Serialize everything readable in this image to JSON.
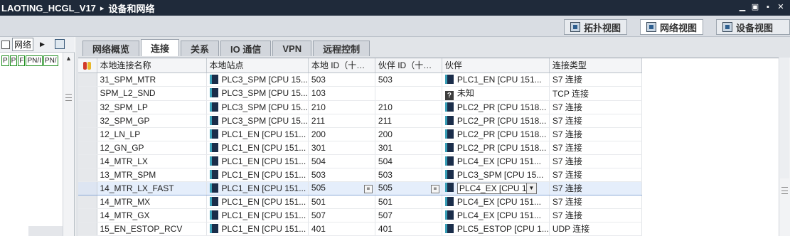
{
  "title": {
    "project": "LAOTING_HCGL_V17",
    "separator": "▸",
    "section": "设备和网络",
    "controls": [
      "▁",
      "▣",
      "▪",
      "✕"
    ]
  },
  "views": [
    {
      "label": "拓扑视图",
      "icon": "topology-view-icon"
    },
    {
      "label": "网络视图",
      "icon": "network-view-icon",
      "active": true
    },
    {
      "label": "设备视图",
      "icon": "device-view-icon"
    }
  ],
  "leftpane": {
    "network_label": "网络",
    "ports": [
      "P",
      "P",
      "F",
      "PN/I",
      "PN/"
    ]
  },
  "tabs": [
    {
      "label": "网络概览"
    },
    {
      "label": "连接",
      "active": true
    },
    {
      "label": "关系"
    },
    {
      "label": "IO 通信"
    },
    {
      "label": "VPN"
    },
    {
      "label": "远程控制"
    }
  ],
  "table": {
    "columns": [
      "本地连接名称",
      "本地站点",
      "本地 ID（十…",
      "伙伴 ID（十…",
      "伙伴",
      "连接类型"
    ],
    "rows": [
      {
        "name": "31_SPM_MTR",
        "station": "PLC3_SPM [CPU 15...",
        "local_id": "503",
        "partner_id": "503",
        "partner": "PLC1_EN [CPU 151...",
        "type": "S7 连接",
        "partner_icon": "device"
      },
      {
        "name": "SPM_L2_SND",
        "station": "PLC3_SPM [CPU 15...",
        "local_id": "103",
        "partner_id": "",
        "partner": "未知",
        "type": "TCP 连接",
        "partner_icon": "unknown"
      },
      {
        "name": "32_SPM_LP",
        "station": "PLC3_SPM [CPU 15...",
        "local_id": "210",
        "partner_id": "210",
        "partner": "PLC2_PR [CPU 1518...",
        "type": "S7 连接",
        "partner_icon": "device"
      },
      {
        "name": "32_SPM_GP",
        "station": "PLC3_SPM [CPU 15...",
        "local_id": "211",
        "partner_id": "211",
        "partner": "PLC2_PR [CPU 1518...",
        "type": "S7 连接",
        "partner_icon": "device"
      },
      {
        "name": "12_LN_LP",
        "station": "PLC1_EN [CPU 151...",
        "local_id": "200",
        "partner_id": "200",
        "partner": "PLC2_PR [CPU 1518...",
        "type": "S7 连接",
        "partner_icon": "device"
      },
      {
        "name": "12_GN_GP",
        "station": "PLC1_EN [CPU 151...",
        "local_id": "301",
        "partner_id": "301",
        "partner": "PLC2_PR [CPU 1518...",
        "type": "S7 连接",
        "partner_icon": "device"
      },
      {
        "name": "14_MTR_LX",
        "station": "PLC1_EN [CPU 151...",
        "local_id": "504",
        "partner_id": "504",
        "partner": "PLC4_EX [CPU 151...",
        "type": "S7 连接",
        "partner_icon": "device"
      },
      {
        "name": "13_MTR_SPM",
        "station": "PLC1_EN [CPU 151...",
        "local_id": "503",
        "partner_id": "503",
        "partner": "PLC3_SPM [CPU 15...",
        "type": "S7 连接",
        "partner_icon": "device"
      },
      {
        "name": "14_MTR_LX_FAST",
        "station": "PLC1_EN [CPU 151...",
        "local_id": "505",
        "partner_id": "505",
        "partner": "PLC4_EX [CPU 1...",
        "type": "S7 连接",
        "partner_icon": "device",
        "selected": true
      },
      {
        "name": "14_MTR_MX",
        "station": "PLC1_EN [CPU 151...",
        "local_id": "501",
        "partner_id": "501",
        "partner": "PLC4_EX [CPU 151...",
        "type": "S7 连接",
        "partner_icon": "device"
      },
      {
        "name": "14_MTR_GX",
        "station": "PLC1_EN [CPU 151...",
        "local_id": "507",
        "partner_id": "507",
        "partner": "PLC4_EX [CPU 151...",
        "type": "S7 连接",
        "partner_icon": "device"
      },
      {
        "name": "15_EN_ESTOP_RCV",
        "station": "PLC1_EN [CPU 151...",
        "local_id": "401",
        "partner_id": "401",
        "partner": "PLC5_ESTOP [CPU 1...",
        "type": "UDP 连接",
        "partner_icon": "device"
      }
    ]
  }
}
